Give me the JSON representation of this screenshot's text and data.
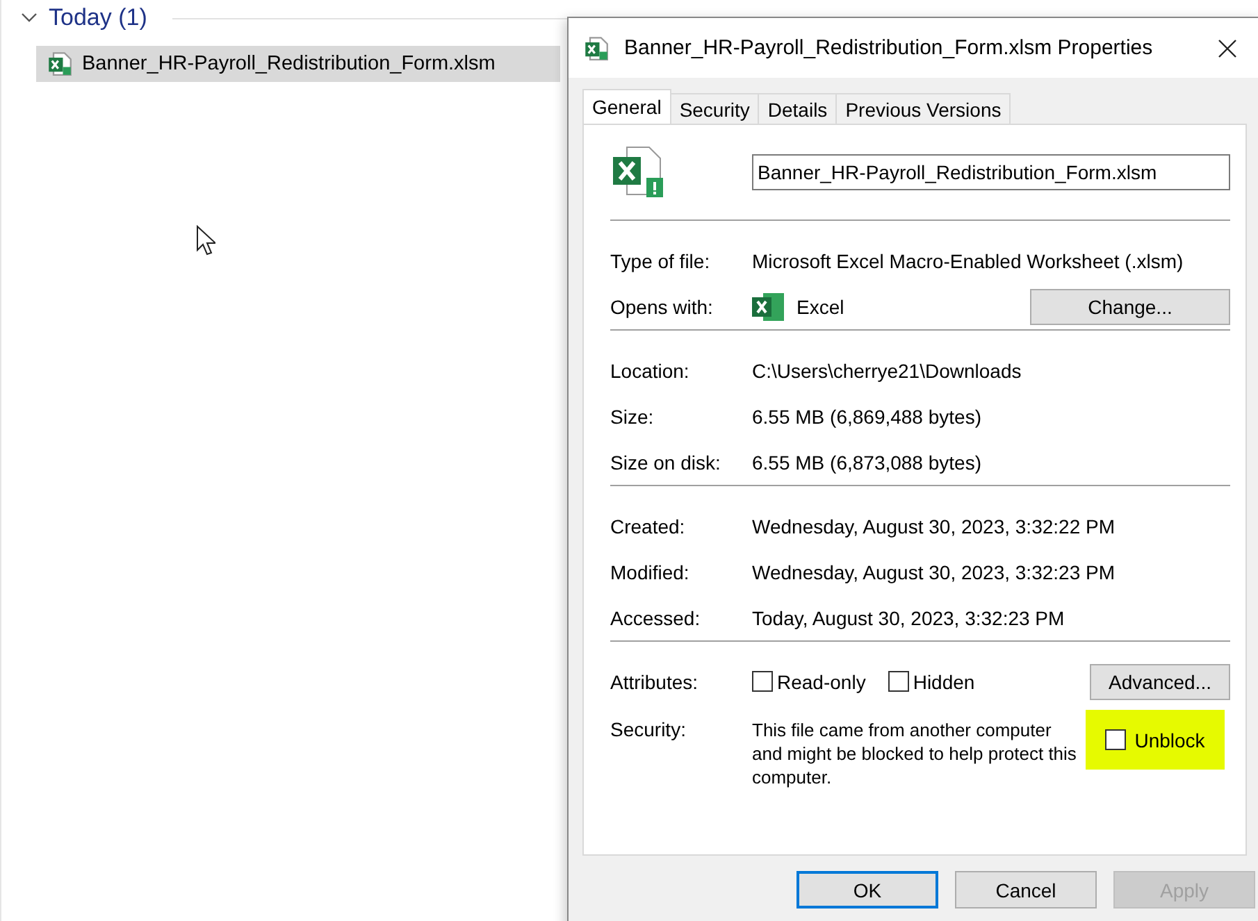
{
  "explorer": {
    "group": {
      "label": "Today (1)",
      "expanded": true
    },
    "files": [
      {
        "name": "Banner_HR-Payroll_Redistribution_Form.xlsm",
        "selected": true
      }
    ]
  },
  "dialog": {
    "title": "Banner_HR-Payroll_Redistribution_Form.xlsm Properties",
    "tabs": [
      {
        "label": "General",
        "selected": true
      },
      {
        "label": "Security",
        "selected": false
      },
      {
        "label": "Details",
        "selected": false
      },
      {
        "label": "Previous Versions",
        "selected": false
      }
    ],
    "filename": "Banner_HR-Payroll_Redistribution_Form.xlsm",
    "type_row": {
      "label": "Type of file:",
      "value": "Microsoft Excel Macro-Enabled Worksheet (.xlsm)"
    },
    "opens_with": {
      "label": "Opens with:",
      "app": "Excel",
      "button": "Change..."
    },
    "location_rows": [
      {
        "label": "Location:",
        "value": "C:\\Users\\cherrye21\\Downloads"
      },
      {
        "label": "Size:",
        "value": "6.55 MB (6,869,488 bytes)"
      },
      {
        "label": "Size on disk:",
        "value": "6.55 MB (6,873,088 bytes)"
      }
    ],
    "date_rows": [
      {
        "label": "Created:",
        "value": "Wednesday, August 30, 2023, 3:32:22 PM"
      },
      {
        "label": "Modified:",
        "value": "Wednesday, August 30, 2023, 3:32:23 PM"
      },
      {
        "label": "Accessed:",
        "value": "Today, August 30, 2023, 3:32:23 PM"
      }
    ],
    "attributes": {
      "label": "Attributes:",
      "checkboxes": [
        {
          "label": "Read-only",
          "checked": false
        },
        {
          "label": "Hidden",
          "checked": false
        }
      ],
      "button": "Advanced..."
    },
    "security": {
      "label": "Security:",
      "text": "This file came from another computer and might be blocked to help protect this computer.",
      "unblock": {
        "label": "Unblock",
        "checked": false,
        "highlighted": true
      }
    },
    "buttons": [
      {
        "label": "OK",
        "default": true,
        "disabled": false
      },
      {
        "label": "Cancel",
        "default": false,
        "disabled": false
      },
      {
        "label": "Apply",
        "default": false,
        "disabled": true
      }
    ]
  }
}
